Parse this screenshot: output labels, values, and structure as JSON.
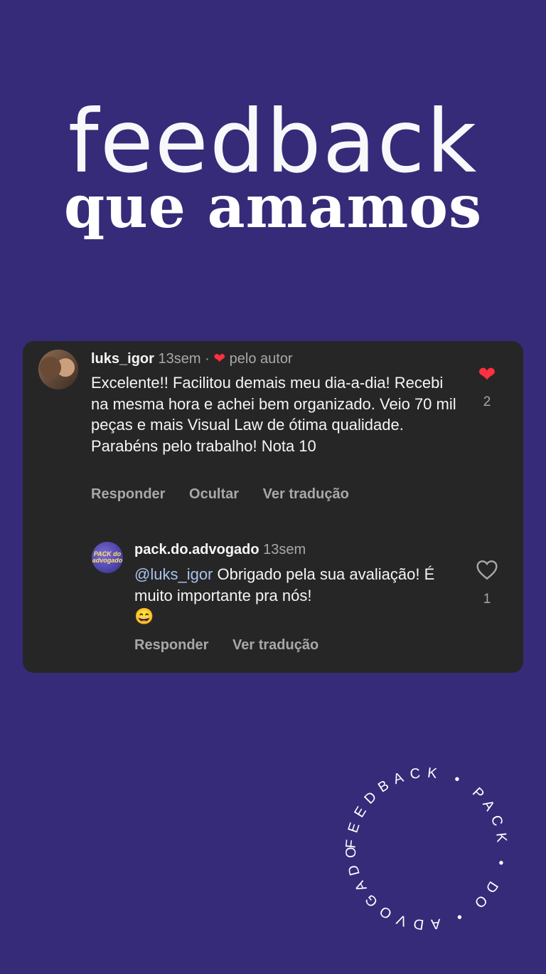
{
  "headline": {
    "line1": "feedback",
    "line2a": "que ",
    "line2b": "amamos"
  },
  "comment": {
    "username": "luks_igor",
    "time": "13sem",
    "separator": "·",
    "liked_by_author": "pelo autor",
    "text": "Excelente!! Facilitou demais meu dia-a-dia! Recebi na mesma hora e achei bem organizado. Veio 70 mil peças e mais Visual Law de ótima qualidade. Parabéns pelo trabalho! Nota 10",
    "actions": {
      "reply": "Responder",
      "hide": "Ocultar",
      "translate": "Ver tradução"
    },
    "likes": "2",
    "liked": true
  },
  "reply": {
    "username": "pack.do.advogado",
    "time": "13sem",
    "avatar_text": "PACK do advogado",
    "mention": "@luks_igor",
    "text": " Obrigado pela sua avaliação! É muito importante pra nós!",
    "emoji": "😄",
    "actions": {
      "reply": "Responder",
      "translate": "Ver tradução"
    },
    "likes": "1",
    "liked": false
  },
  "seal_text": "FEEDBACK • PACK • DO • ADVOGADO • ",
  "colors": {
    "background": "#352b79",
    "card": "#262626",
    "like": "#ff3040",
    "mention": "#a9c3ee"
  }
}
